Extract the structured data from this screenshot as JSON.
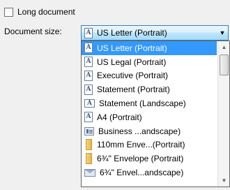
{
  "long_document": {
    "label": "Long document",
    "checked": false
  },
  "document_size": {
    "label": "Document size:",
    "selected": "US Letter (Portrait)",
    "options": [
      {
        "label": "US Letter (Portrait)",
        "icon": "portrait-page-icon",
        "selected": true
      },
      {
        "label": "US Legal (Portrait)",
        "icon": "portrait-page-icon",
        "selected": false
      },
      {
        "label": "Executive (Portrait)",
        "icon": "portrait-page-icon",
        "selected": false
      },
      {
        "label": "Statement (Portrait)",
        "icon": "portrait-page-icon",
        "selected": false
      },
      {
        "label": "Statement (Landscape)",
        "icon": "landscape-page-icon",
        "selected": false
      },
      {
        "label": "A4 (Portrait)",
        "icon": "portrait-page-icon",
        "selected": false
      },
      {
        "label": "Business ...andscape)",
        "icon": "business-card-icon",
        "selected": false
      },
      {
        "label": "110mm Enve...(Portrait)",
        "icon": "envelope-portrait-icon",
        "selected": false
      },
      {
        "label": "6¾\" Envelope (Portrait)",
        "icon": "envelope-portrait-icon",
        "selected": false
      },
      {
        "label": "6¾\" Envel...andscape)",
        "icon": "envelope-landscape-icon",
        "selected": false
      }
    ]
  },
  "colors": {
    "selection": "#3399ff",
    "combo_border": "#3c7fb1"
  }
}
